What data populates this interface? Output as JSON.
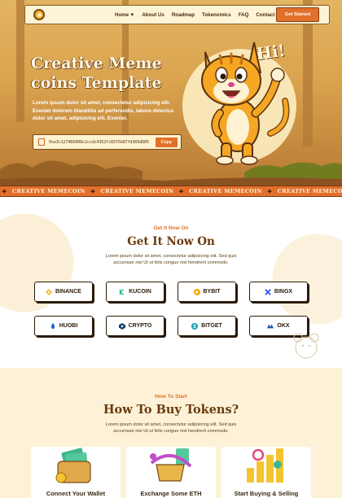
{
  "nav": {
    "items": [
      "Home",
      "About Us",
      "Roadmap",
      "Tokenomics",
      "FAQ",
      "Contact"
    ],
    "cta": "Get Started"
  },
  "hero": {
    "title_line1": "Creative Meme",
    "title_line2": "coins Template",
    "description": "Lorem ipsum dolor sit amet, consectetur adipisicing elit. Eveniet dolorem blanditiis ad perferendis, labore delectus dolor sit amet, adipisicing elit. Eveniet.",
    "contract_address": "0xe3c127466908c2ccdc4352fc83f5b87fd369d605",
    "copy_label": "Copy",
    "speech": "Hi!"
  },
  "ticker": {
    "text": "CREATIVE MEMECOIN",
    "repeat": 5
  },
  "exchanges": {
    "eyebrow": "Get It Now On",
    "title": "Get It Now On",
    "description": "Lorem ipsum dolor sit amet, consectetur adipisicing elit. Sed quis accumsan nisi Ut ut felis congue nisl hendrerit commodo.",
    "items": [
      {
        "name": "BINANCE",
        "icon": "binance-icon",
        "color": "#f3ba2f"
      },
      {
        "name": "KUCOIN",
        "icon": "kucoin-icon",
        "color": "#23af91"
      },
      {
        "name": "BYBIT",
        "icon": "bybit-icon",
        "color": "#f7a600"
      },
      {
        "name": "BINGX",
        "icon": "bingx-icon",
        "color": "#2a54ff"
      },
      {
        "name": "HUOBI",
        "icon": "huobi-icon",
        "color": "#1b62d8"
      },
      {
        "name": "CRYPTO",
        "icon": "crypto-icon",
        "color": "#103f68"
      },
      {
        "name": "BITGET",
        "icon": "bitget-icon",
        "color": "#1da2b4"
      },
      {
        "name": "OKX",
        "icon": "okx-icon",
        "color": "#1c4fbf"
      }
    ]
  },
  "howto": {
    "eyebrow": "How To Start",
    "title": "How To Buy Tokens?",
    "description": "Lorem ipsum dolor sit amet, consectetur adipisicing elit. Sed quis accumsan nisi Ut ut felis congue nisl hendrerit commodo.",
    "cards": [
      {
        "title": "Connect Your Wallet",
        "icon": "wallet-icon"
      },
      {
        "title": "Exchange Some ETH",
        "icon": "exchange-icon"
      },
      {
        "title": "Start Buying & Selling",
        "icon": "chart-coins-icon"
      }
    ]
  },
  "colors": {
    "accent": "#e0702a",
    "brown": "#6b3a0c",
    "cream": "#fdf2d8"
  }
}
